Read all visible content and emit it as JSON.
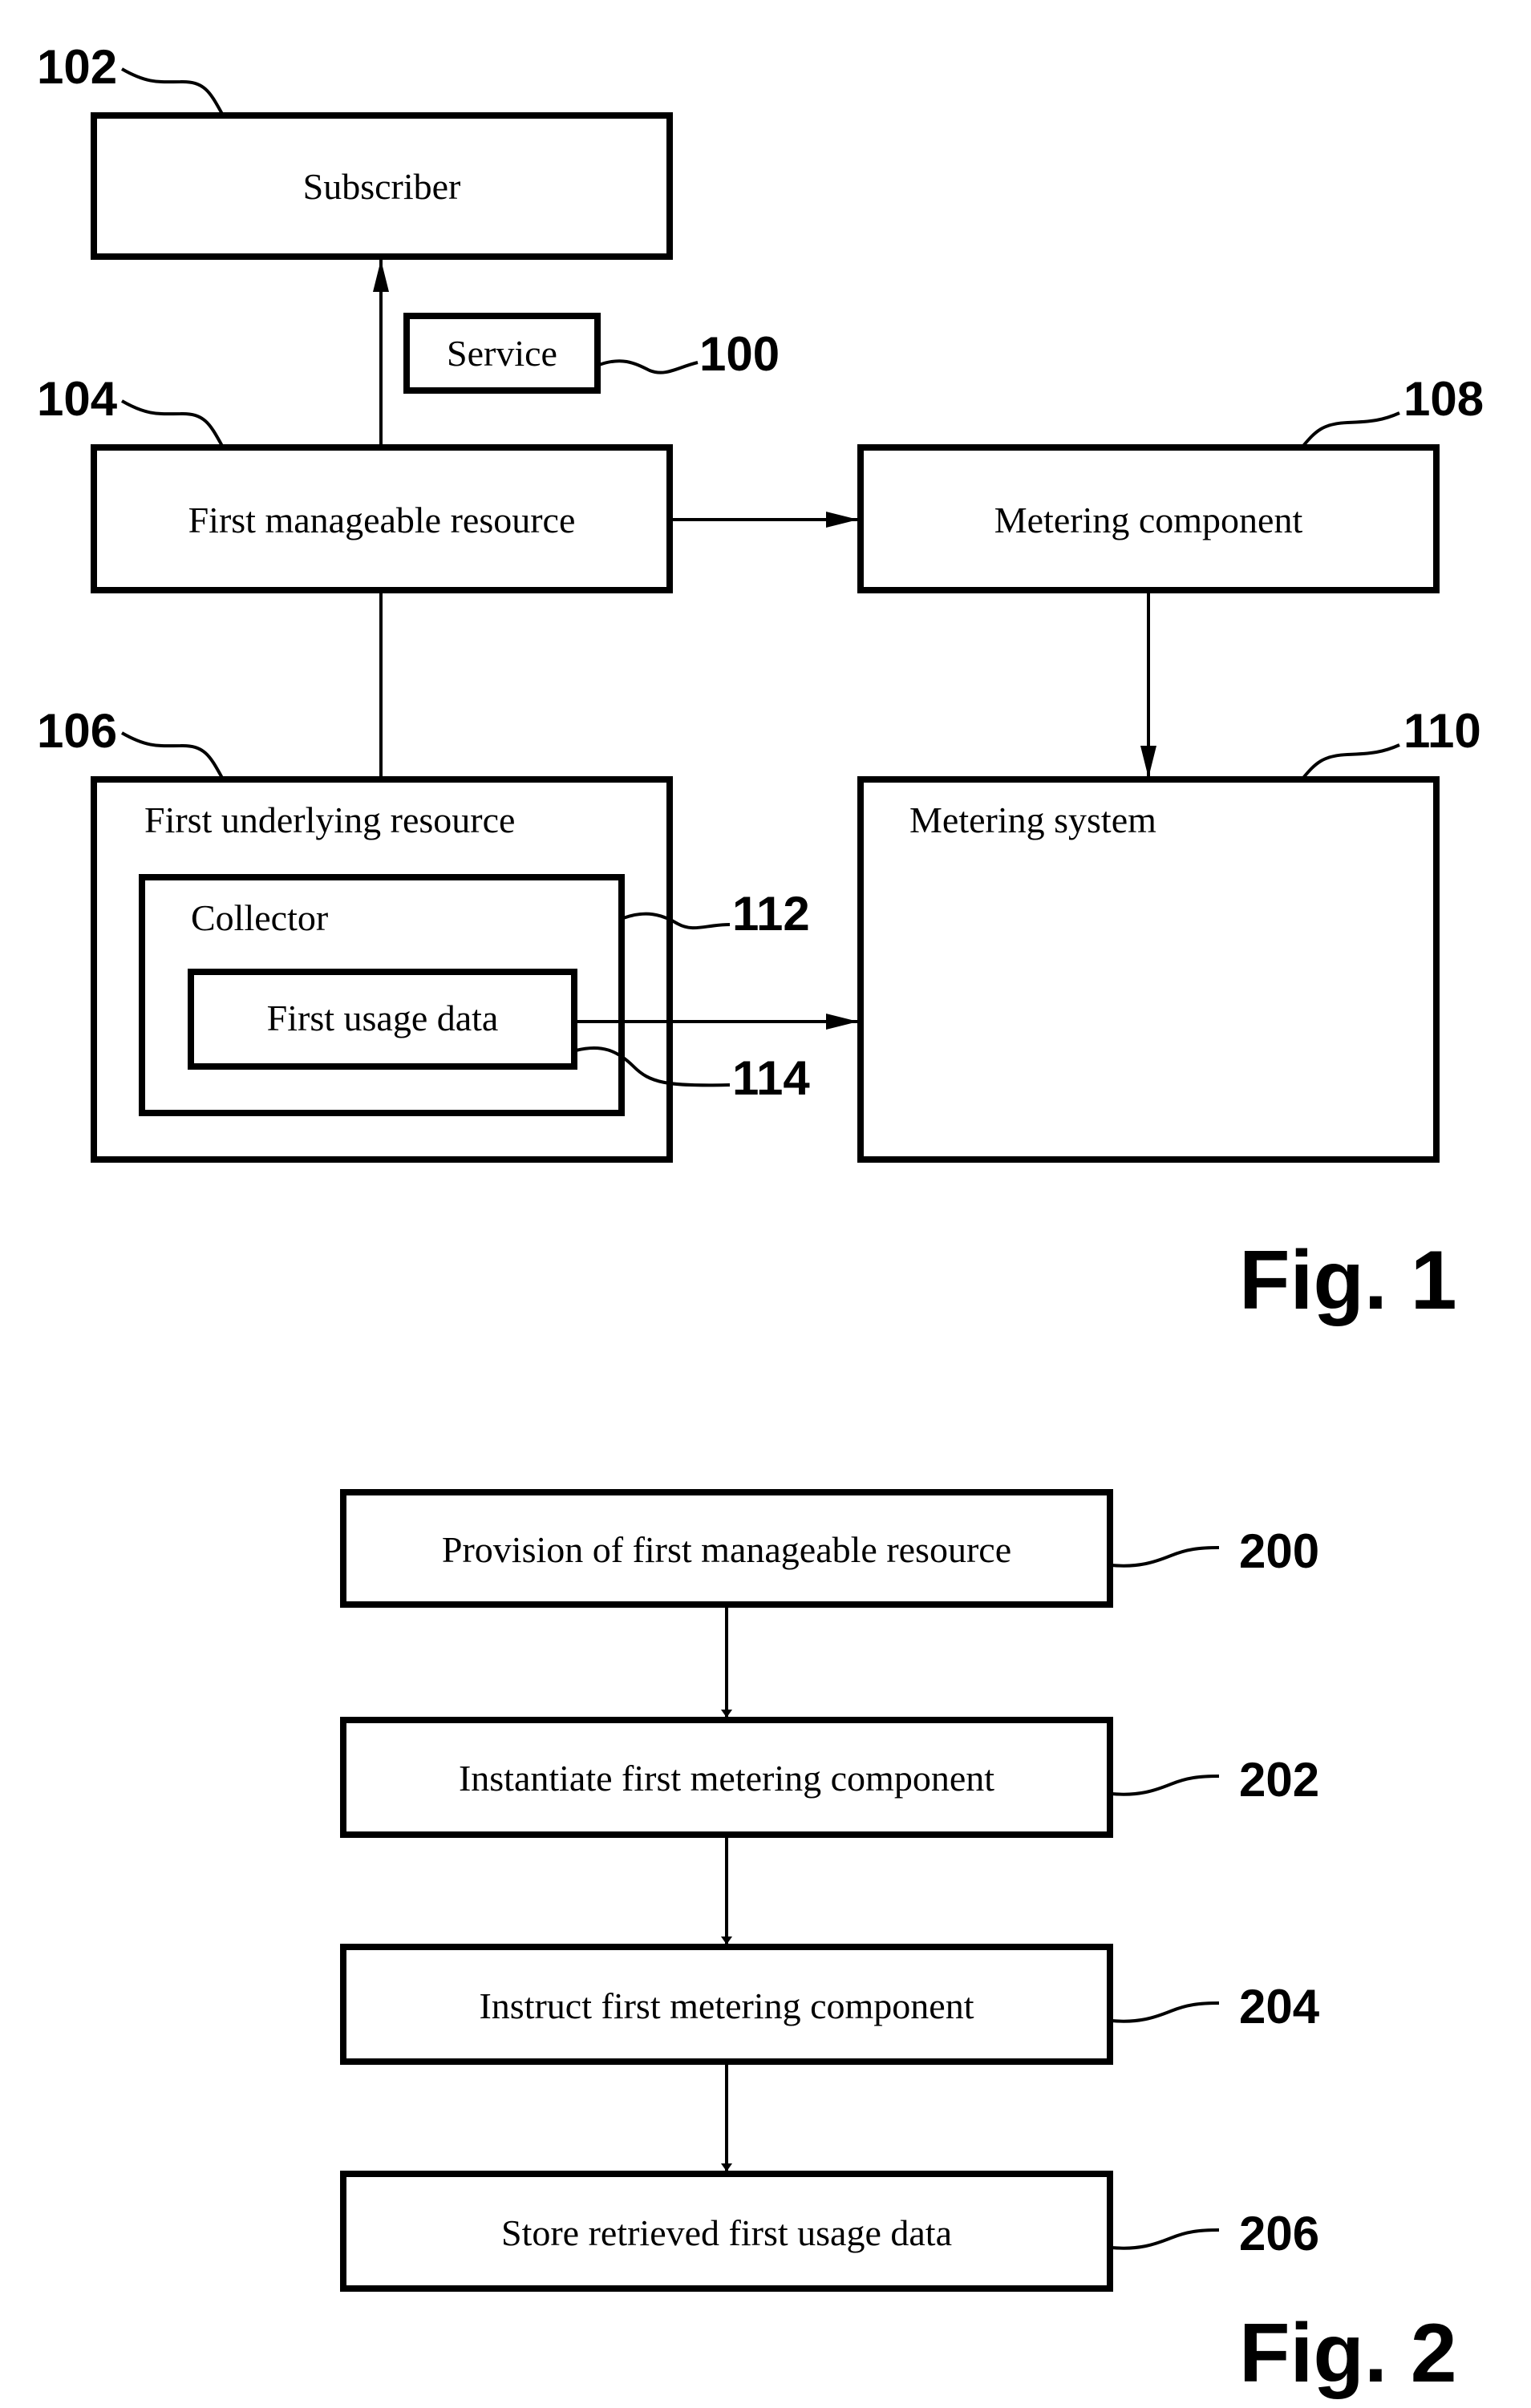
{
  "fig1": {
    "caption": "Fig. 1",
    "boxes": {
      "subscriber": {
        "label": "Subscriber",
        "ref": "102"
      },
      "service": {
        "label": "Service",
        "ref": "100"
      },
      "first_manageable_resource": {
        "label": "First manageable resource",
        "ref": "104"
      },
      "metering_component": {
        "label": "Metering component",
        "ref": "108"
      },
      "first_underlying_resource": {
        "label": "First underlying resource",
        "ref": "106"
      },
      "collector": {
        "label": "Collector",
        "ref": "112"
      },
      "first_usage_data": {
        "label": "First usage data",
        "ref": "114"
      },
      "metering_system": {
        "label": "Metering system",
        "ref": "110"
      }
    }
  },
  "fig2": {
    "caption": "Fig. 2",
    "steps": [
      {
        "label": "Provision of first manageable resource",
        "ref": "200"
      },
      {
        "label": "Instantiate first metering component",
        "ref": "202"
      },
      {
        "label": "Instruct first metering component",
        "ref": "204"
      },
      {
        "label": "Store retrieved first usage data",
        "ref": "206"
      }
    ]
  }
}
